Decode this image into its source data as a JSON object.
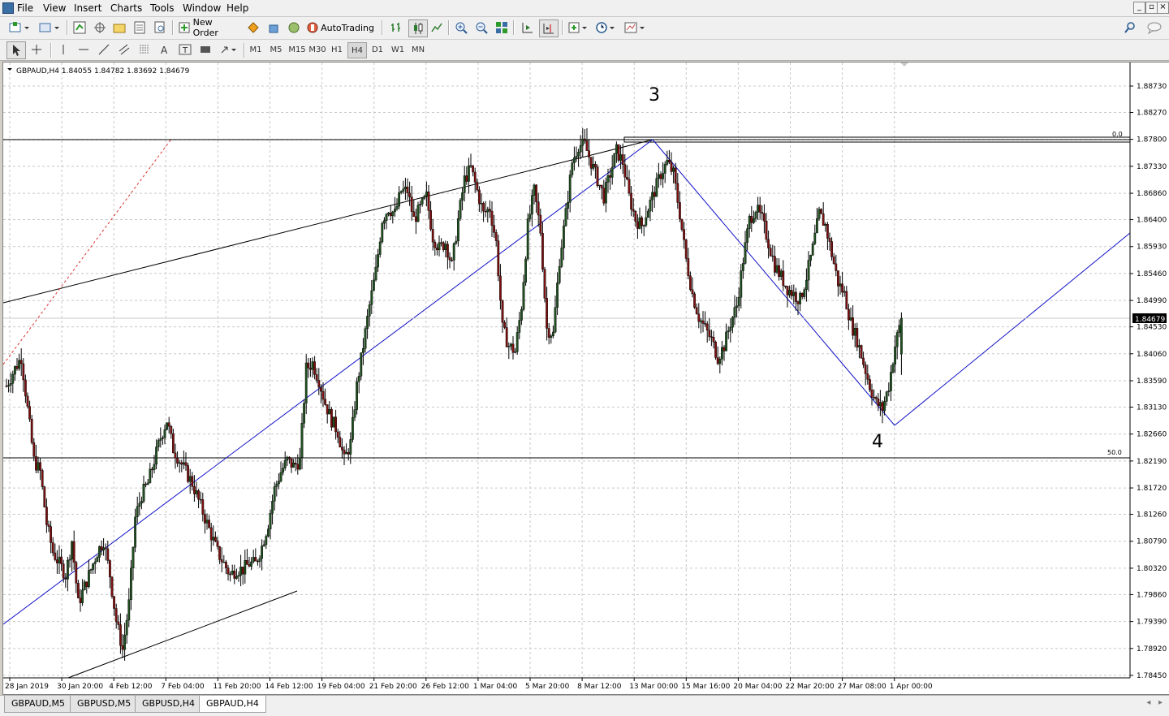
{
  "menu": [
    "File",
    "View",
    "Insert",
    "Charts",
    "Tools",
    "Window",
    "Help"
  ],
  "toolbar": {
    "new_order": "New Order",
    "autotrading": "AutoTrading",
    "timeframes": [
      "M1",
      "M5",
      "M15",
      "M30",
      "H1",
      "H4",
      "D1",
      "W1",
      "MN"
    ],
    "active_timeframe": "H4"
  },
  "chart": {
    "header": "GBPAUD,H4  1.84055 1.84782 1.83692 1.84679",
    "current_price": "1.84679",
    "wave_labels": [
      "3",
      "4"
    ],
    "fib_labels": [
      "0.0",
      "50.0"
    ]
  },
  "chart_data": {
    "type": "candlestick",
    "symbol": "GBPAUD",
    "timeframe": "H4",
    "ohlc_last": [
      1.84055,
      1.84782,
      1.83692,
      1.84679
    ],
    "price_ticks": [
      "1.88730",
      "1.88270",
      "1.87800",
      "1.87330",
      "1.86860",
      "1.86400",
      "1.85930",
      "1.85460",
      "1.84990",
      "1.84530",
      "1.84060",
      "1.83590",
      "1.83130",
      "1.82660",
      "1.82190",
      "1.81720",
      "1.81260",
      "1.80790",
      "1.80320",
      "1.79860",
      "1.79390",
      "1.78920",
      "1.78450"
    ],
    "time_ticks": [
      "28 Jan 2019",
      "30 Jan 20:00",
      "4 Feb 12:00",
      "7 Feb 04:00",
      "11 Feb 20:00",
      "14 Feb 12:00",
      "19 Feb 04:00",
      "21 Feb 20:00",
      "26 Feb 12:00",
      "1 Mar 04:00",
      "5 Mar 20:00",
      "8 Mar 12:00",
      "13 Mar 00:00",
      "15 Mar 16:00",
      "20 Mar 04:00",
      "22 Mar 20:00",
      "27 Mar 08:00",
      "1 Apr 00:00"
    ],
    "close_path": [
      [
        0,
        1.835
      ],
      [
        4,
        1.838
      ],
      [
        7,
        1.84
      ],
      [
        10,
        1.831
      ],
      [
        13,
        1.822
      ],
      [
        16,
        1.82
      ],
      [
        19,
        1.811
      ],
      [
        22,
        1.806
      ],
      [
        25,
        1.804
      ],
      [
        28,
        1.802
      ],
      [
        31,
        1.808
      ],
      [
        34,
        1.797
      ],
      [
        37,
        1.8
      ],
      [
        40,
        1.803
      ],
      [
        43,
        1.806
      ],
      [
        46,
        1.808
      ],
      [
        49,
        1.802
      ],
      [
        52,
        1.794
      ],
      [
        55,
        1.789
      ],
      [
        58,
        1.797
      ],
      [
        61,
        1.812
      ],
      [
        64,
        1.816
      ],
      [
        67,
        1.818
      ],
      [
        70,
        1.822
      ],
      [
        73,
        1.826
      ],
      [
        76,
        1.829
      ],
      [
        79,
        1.824
      ],
      [
        82,
        1.822
      ],
      [
        85,
        1.82
      ],
      [
        88,
        1.818
      ],
      [
        91,
        1.815
      ],
      [
        94,
        1.812
      ],
      [
        97,
        1.809
      ],
      [
        100,
        1.806
      ],
      [
        103,
        1.804
      ],
      [
        106,
        1.802
      ],
      [
        109,
        1.803
      ],
      [
        112,
        1.803
      ],
      [
        115,
        1.804
      ],
      [
        118,
        1.804
      ],
      [
        121,
        1.807
      ],
      [
        124,
        1.811
      ],
      [
        127,
        1.817
      ],
      [
        130,
        1.82
      ],
      [
        133,
        1.822
      ],
      [
        136,
        1.821
      ],
      [
        139,
        1.822
      ],
      [
        142,
        1.838
      ],
      [
        145,
        1.839
      ],
      [
        148,
        1.836
      ],
      [
        151,
        1.832
      ],
      [
        154,
        1.829
      ],
      [
        157,
        1.827
      ],
      [
        160,
        1.822
      ],
      [
        163,
        1.825
      ],
      [
        166,
        1.835
      ],
      [
        169,
        1.842
      ],
      [
        172,
        1.849
      ],
      [
        175,
        1.855
      ],
      [
        178,
        1.864
      ],
      [
        181,
        1.866
      ],
      [
        184,
        1.865
      ],
      [
        187,
        1.869
      ],
      [
        190,
        1.869
      ],
      [
        193,
        1.864
      ],
      [
        196,
        1.866
      ],
      [
        199,
        1.868
      ],
      [
        202,
        1.861
      ],
      [
        205,
        1.859
      ],
      [
        208,
        1.86
      ],
      [
        211,
        1.856
      ],
      [
        214,
        1.864
      ],
      [
        217,
        1.871
      ],
      [
        220,
        1.873
      ],
      [
        223,
        1.869
      ],
      [
        226,
        1.865
      ],
      [
        229,
        1.866
      ],
      [
        232,
        1.86
      ],
      [
        235,
        1.845
      ],
      [
        238,
        1.842
      ],
      [
        241,
        1.841
      ],
      [
        244,
        1.849
      ],
      [
        247,
        1.863
      ],
      [
        250,
        1.869
      ],
      [
        253,
        1.862
      ],
      [
        256,
        1.845
      ],
      [
        259,
        1.844
      ],
      [
        262,
        1.857
      ],
      [
        265,
        1.865
      ],
      [
        268,
        1.874
      ],
      [
        271,
        1.877
      ],
      [
        274,
        1.877
      ],
      [
        277,
        1.874
      ],
      [
        280,
        1.871
      ],
      [
        283,
        1.868
      ],
      [
        286,
        1.872
      ],
      [
        289,
        1.876
      ],
      [
        292,
        1.874
      ],
      [
        295,
        1.868
      ],
      [
        298,
        1.864
      ],
      [
        301,
        1.863
      ],
      [
        304,
        1.866
      ],
      [
        307,
        1.869
      ],
      [
        310,
        1.872
      ],
      [
        313,
        1.874
      ],
      [
        316,
        1.872
      ],
      [
        319,
        1.865
      ],
      [
        322,
        1.857
      ],
      [
        325,
        1.851
      ],
      [
        328,
        1.847
      ],
      [
        331,
        1.845
      ],
      [
        334,
        1.843
      ],
      [
        337,
        1.84
      ],
      [
        340,
        1.842
      ],
      [
        343,
        1.846
      ],
      [
        346,
        1.849
      ],
      [
        349,
        1.857
      ],
      [
        352,
        1.864
      ],
      [
        355,
        1.866
      ],
      [
        358,
        1.864
      ],
      [
        361,
        1.86
      ],
      [
        364,
        1.856
      ],
      [
        367,
        1.854
      ],
      [
        370,
        1.852
      ],
      [
        373,
        1.851
      ],
      [
        376,
        1.85
      ],
      [
        379,
        1.854
      ],
      [
        382,
        1.859
      ],
      [
        385,
        1.865
      ],
      [
        388,
        1.863
      ],
      [
        391,
        1.858
      ],
      [
        394,
        1.853
      ],
      [
        397,
        1.851
      ],
      [
        400,
        1.846
      ],
      [
        403,
        1.843
      ],
      [
        406,
        1.839
      ],
      [
        409,
        1.835
      ],
      [
        412,
        1.832
      ],
      [
        415,
        1.831
      ],
      [
        418,
        1.835
      ],
      [
        421,
        1.842
      ],
      [
        424,
        1.8468
      ]
    ]
  }
}
